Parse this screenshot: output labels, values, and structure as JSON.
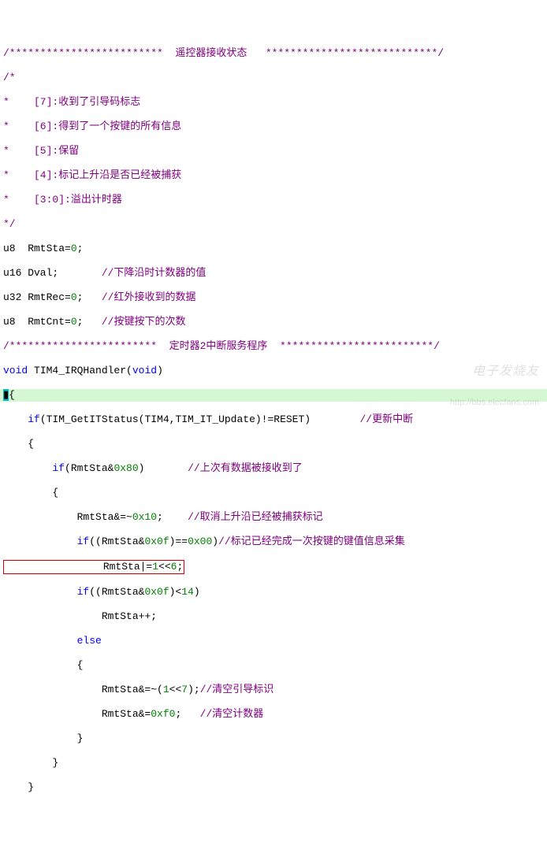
{
  "lines": {
    "l1": "/*************************  遥控器接收状态   ****************************/",
    "l2": "/*",
    "l3": "*    [7]:收到了引导码标志",
    "l4": "*    [6]:得到了一个按键的所有信息",
    "l5": "*    [5]:保留",
    "l6": "*    [4]:标记上升沿是否已经被捕获",
    "l7": "*    [3:0]:溢出计时器",
    "l8": "*/",
    "l9a": "u8  RmtSta=",
    "l9b": "0",
    "l9c": ";",
    "l10a": "u16 Dval;",
    "l10b": "       //下降沿时计数器的值",
    "l11a": "u32 RmtRec=",
    "l11b": "0",
    "l11c": ";",
    "l11d": "   //红外接收到的数据",
    "l12a": "u8  RmtCnt=",
    "l12b": "0",
    "l12c": ";",
    "l12d": "   //按键按下的次数",
    "l13": "/************************  定时器2中断服务程序  *************************/",
    "l14a": "void",
    "l14b": " TIM4_IRQHandler(",
    "l14c": "void",
    "l14d": ")",
    "l15a": "{",
    "l16a": "    ",
    "l16b": "if",
    "l16c": "(TIM_GetITStatus(TIM4,TIM_IT_Update)!=RESET)        ",
    "l16d": "//更新中断",
    "l17": "    {",
    "l18a": "        ",
    "l18b": "if",
    "l18c": "(RmtSta&",
    "l18d": "0x80",
    "l18e": ")",
    "l18f": "       //上次有数据被接收到了",
    "l19": "        {",
    "l20a": "            RmtSta&=~",
    "l20b": "0x10",
    "l20c": ";",
    "l20d": "    //取消上升沿已经被捕获标记",
    "l21a": "            ",
    "l21b": "if",
    "l21c": "((RmtSta&",
    "l21d": "0x0f",
    "l21e": ")==",
    "l21f": "0x00",
    "l21g": ")",
    "l21h": "//标记已经完成一次按键的键值信息采集",
    "l22a": "                RmtSta|=",
    "l22b": "1",
    "l22c": "<<",
    "l22d": "6",
    "l22e": ";",
    "l23a": "            ",
    "l23b": "if",
    "l23c": "((RmtSta&",
    "l23d": "0x0f",
    "l23e": ")<",
    "l23f": "14",
    "l23g": ")",
    "l24": "                RmtSta++;",
    "l25a": "            ",
    "l25b": "else",
    "l26": "            {",
    "l27a": "                RmtSta&=~(",
    "l27b": "1",
    "l27c": "<<",
    "l27d": "7",
    "l27e": ");",
    "l27f": "//清空引导标识",
    "l28a": "                RmtSta&=",
    "l28b": "0xf0",
    "l28c": ";",
    "l28d": "   //清空计数器",
    "l29": "            }",
    "l30": "        }",
    "l31": "    }",
    "cursor": "▮"
  },
  "watermark": {
    "logo": "电子发烧友",
    "url": "http://bbs.elecfans.com"
  }
}
